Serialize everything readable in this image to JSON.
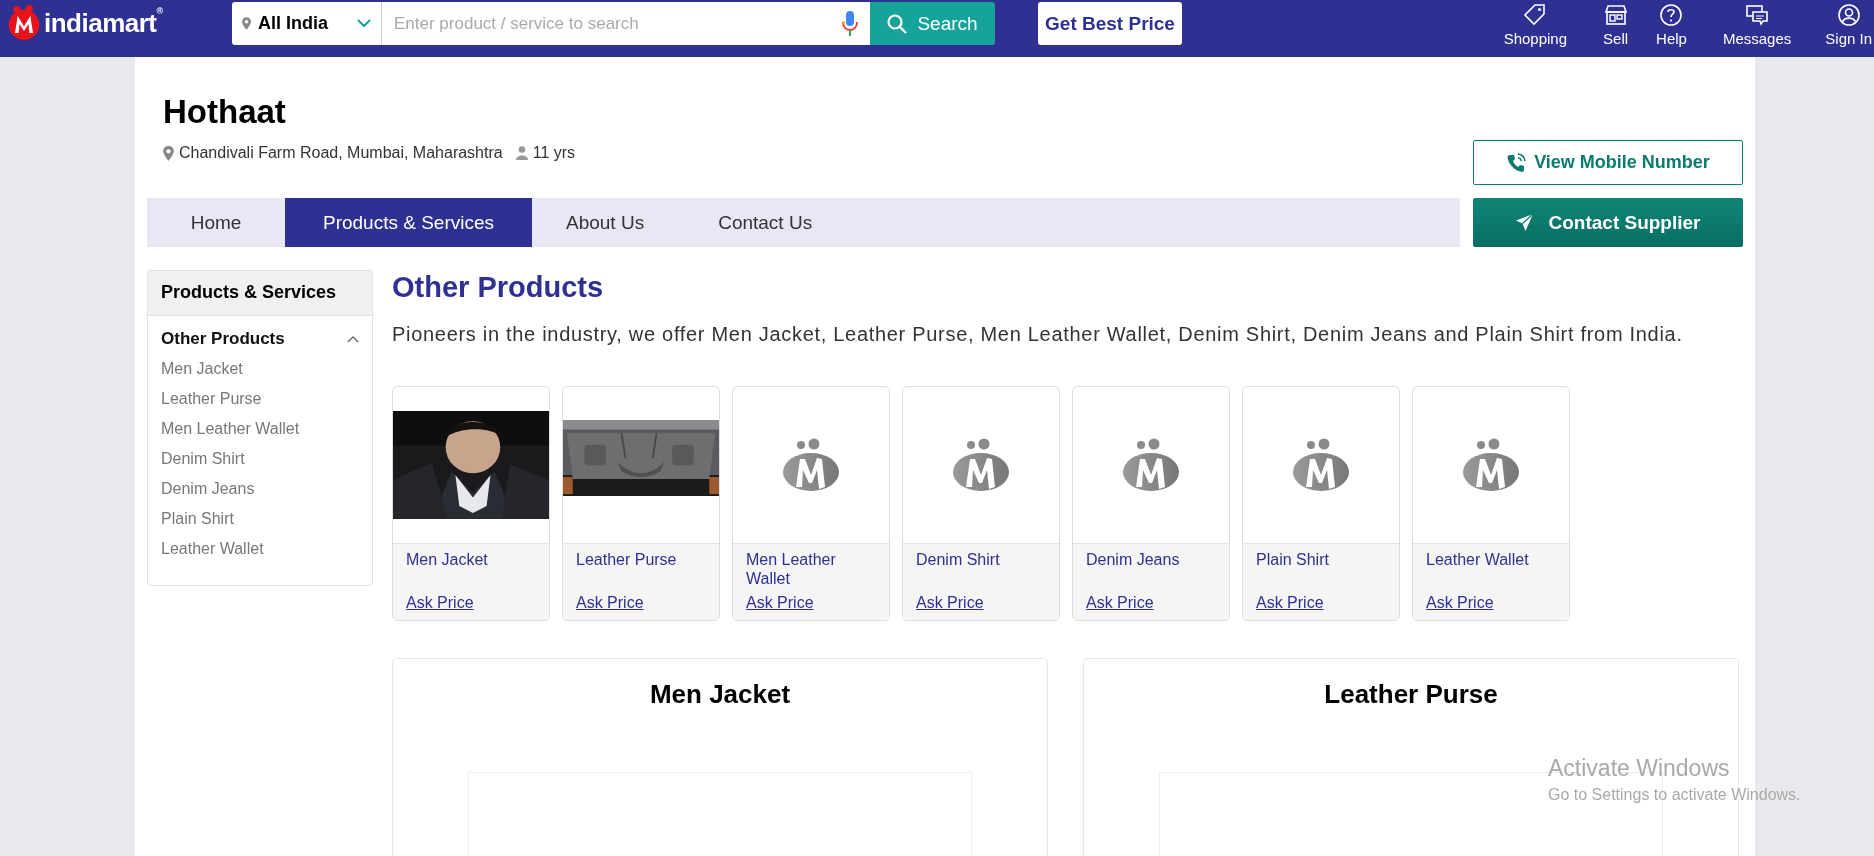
{
  "header": {
    "logo": "indiamart$^{®}$",
    "location": "All India",
    "search": {
      "placeholder": "Enter product / service to search"
    },
    "search_button": "Search",
    "best_price_button": "Get Best Price",
    "nav": [
      {
        "label": "Shopping",
        "kind": "tag"
      },
      {
        "label": "Sell",
        "kind": "store"
      },
      {
        "label": "Help",
        "kind": "help"
      },
      {
        "label": "Messages",
        "kind": "chat"
      },
      {
        "label": "Sign In",
        "kind": "user"
      }
    ]
  },
  "company": {
    "name": "Hothaat",
    "address": "Chandivali Farm Road, Mumbai, Maharashtra",
    "experience": "11 yrs"
  },
  "actions": {
    "view_mobile": "View Mobile Number",
    "contact_supplier": "Contact Supplier"
  },
  "tabs": [
    {
      "label": "Home",
      "selected": false
    },
    {
      "label": "Products & Services",
      "selected": true
    },
    {
      "label": "About Us",
      "selected": false
    },
    {
      "label": "Contact Us",
      "selected": false
    }
  ],
  "sidebar": {
    "title": "Products & Services",
    "group": {
      "label": "Other Products",
      "expanded": true,
      "items": [
        "Men Jacket",
        "Leather Purse",
        "Men Leather Wallet",
        "Denim Shirt",
        "Denim Jeans",
        "Plain Shirt",
        "Leather Wallet"
      ]
    }
  },
  "section": {
    "title": "Other Products",
    "description": "Pioneers in the industry, we offer Men Jacket, Leather Purse, Men Leather Wallet, Denim Shirt, Denim Jeans and Plain Shirt from India.",
    "products": [
      {
        "name": "Men Jacket",
        "kind": "jacket",
        "link": "Ask Price"
      },
      {
        "name": "Leather Purse",
        "kind": "purse",
        "link": "Ask Price"
      },
      {
        "name": "Men Leather Wallet",
        "kind": "placeholder",
        "link": "Ask Price"
      },
      {
        "name": "Denim Shirt",
        "kind": "placeholder",
        "link": "Ask Price"
      },
      {
        "name": "Denim Jeans",
        "kind": "placeholder",
        "link": "Ask Price"
      },
      {
        "name": "Plain Shirt",
        "kind": "placeholder",
        "link": "Ask Price"
      },
      {
        "name": "Leather Wallet",
        "kind": "placeholder",
        "link": "Ask Price"
      }
    ]
  },
  "details": [
    {
      "title": "Men Jacket"
    },
    {
      "title": "Leather Purse"
    }
  ],
  "os_notice": {
    "title": "Activate Windows",
    "subtitle": "Go to Settings to activate Windows."
  }
}
